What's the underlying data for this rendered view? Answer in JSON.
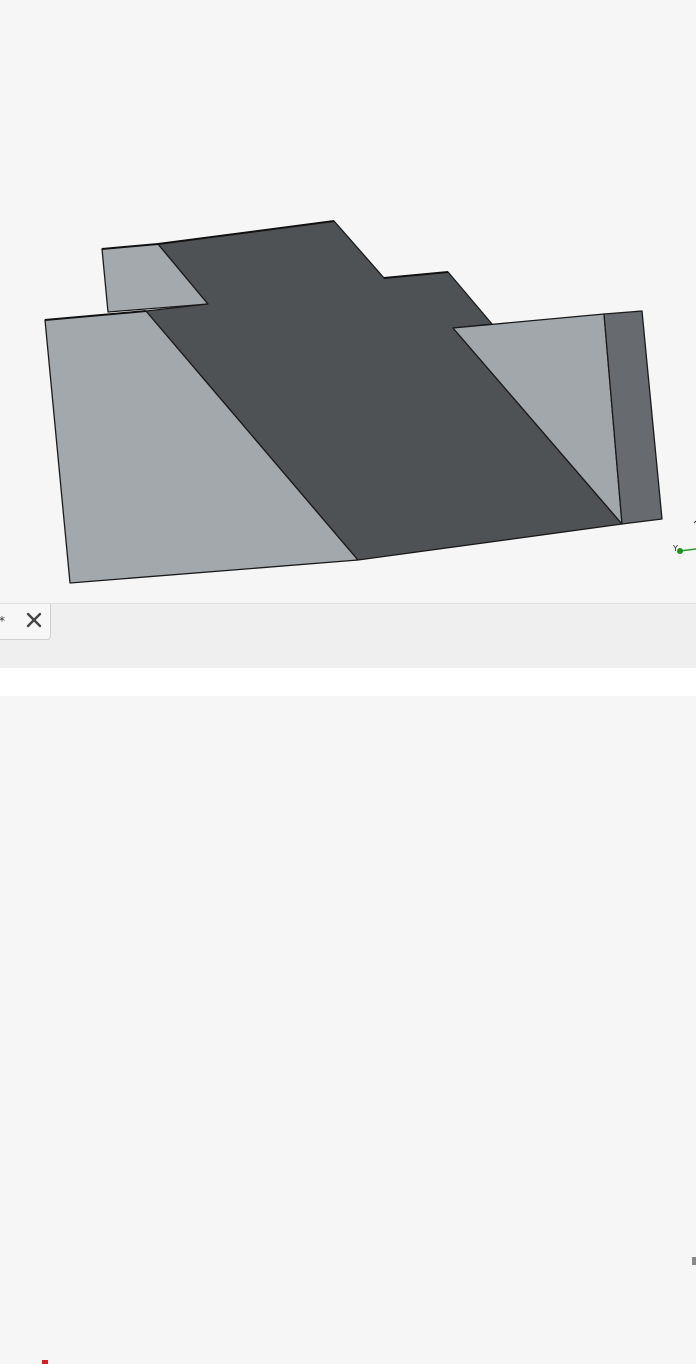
{
  "viewport": {
    "model_name": "3D part model",
    "axis_triad": {
      "x_label": "",
      "y_label": "Y",
      "z_label": "",
      "colors": {
        "x": "#d02a2a",
        "y": "#2c9a2c",
        "origin": "#1f8f1f"
      }
    },
    "colors": {
      "background": "#f6f6f6",
      "dark_face": "#4f5255",
      "light_face": "#a3a8ad",
      "side_face": "#676a6e",
      "edge": "#1a1a1a"
    }
  },
  "tabs": [
    {
      "label": "*",
      "close_icon": "close-icon"
    }
  ]
}
